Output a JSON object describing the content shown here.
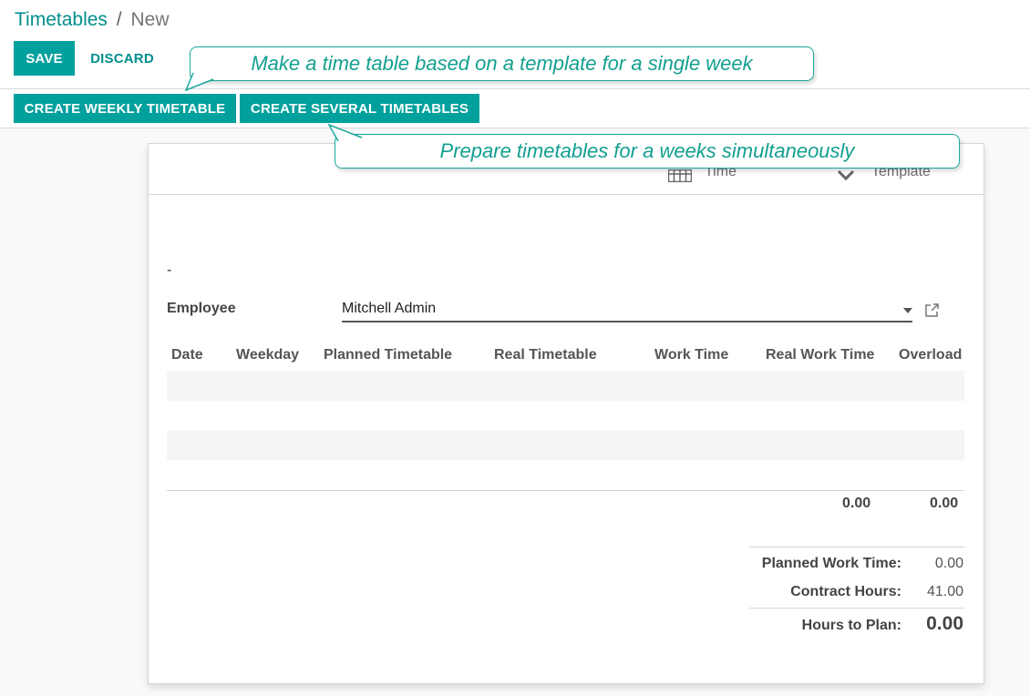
{
  "breadcrumb": {
    "parent": "Timetables",
    "separator": "/",
    "current": "New"
  },
  "toolbar": {
    "save_label": "SAVE",
    "discard_label": "DISCARD"
  },
  "actions": {
    "create_weekly_label": "CREATE WEEKLY TIMETABLE",
    "create_several_label": "CREATE SEVERAL TIMETABLES"
  },
  "callouts": {
    "weekly": "Make a time table based on a template for a single week",
    "several": "Prepare timetables for a weeks simultaneously"
  },
  "stat_buttons": {
    "time": {
      "label": "Time",
      "icon": "calendar-icon"
    },
    "template": {
      "label": "Template",
      "icon": "chevron-down-icon"
    }
  },
  "form": {
    "title_placeholder": "-",
    "employee": {
      "label": "Employee",
      "value": "Mitchell Admin"
    }
  },
  "table": {
    "columns": [
      "Date",
      "Weekday",
      "Planned Timetable",
      "Real Timetable",
      "Work Time",
      "Real Work Time",
      "Overload"
    ],
    "totals": {
      "real_work_time": "0.00",
      "overload": "0.00"
    }
  },
  "summary": {
    "planned_work_time": {
      "label": "Planned Work Time:",
      "value": "0.00"
    },
    "contract_hours": {
      "label": "Contract Hours:",
      "value": "41.00"
    },
    "hours_to_plan": {
      "label": "Hours to Plan:",
      "value": "0.00"
    }
  },
  "colors": {
    "accent": "#00a09d",
    "callout_border": "#19a89b",
    "callout_text": "#13a090"
  }
}
